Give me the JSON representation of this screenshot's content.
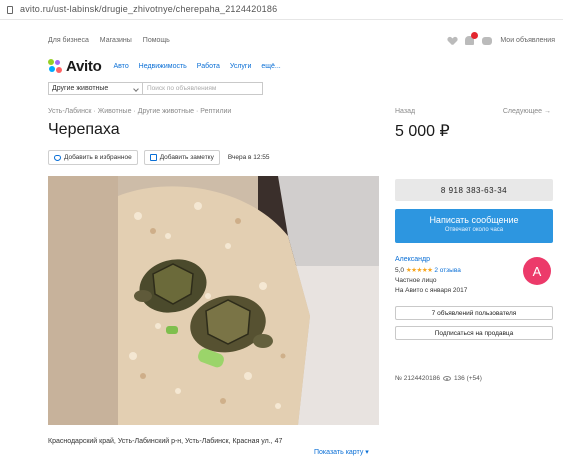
{
  "browser": {
    "url": "avito.ru/ust-labinsk/drugie_zhivotnye/cherepaha_2124420186"
  },
  "topnav": {
    "links": [
      "Для бизнеса",
      "Магазины",
      "Помощь"
    ],
    "my_ads": "Мои объявления"
  },
  "header": {
    "logo_text": "Avito",
    "category_links": [
      "Авто",
      "Недвижимость",
      "Работа",
      "Услуги",
      "ещё..."
    ]
  },
  "search": {
    "category_value": "Другие животные",
    "placeholder": "Поиск по объявлениям"
  },
  "breadcrumb": {
    "items": [
      "Усть-Лабинск",
      "Животные",
      "Другие животные",
      "Рептилии"
    ],
    "separator": " · "
  },
  "nav": {
    "prev": "Назад",
    "next": "Следующее →"
  },
  "listing": {
    "title": "Черепаха",
    "price": "5 000 ₽",
    "add_favorite": "Добавить в избранное",
    "add_note": "Добавить заметку",
    "views_today": "Вчера в 12:55",
    "address": "Краснодарский край, Усть-Лабинский р-н, Усть-Лабинск, Красная ул., 47",
    "show_map": "Показать карту ▾"
  },
  "seller": {
    "phone": "8 918 383-63-34",
    "message_button": "Написать сообщение",
    "message_sub": "Отвечает около часа",
    "name": "Александр",
    "rating": "5,0",
    "stars": "★★★★★",
    "reviews": "2 отзыва",
    "type": "Частное лицо",
    "since": "На Авито с января 2017",
    "avatar_letter": "А",
    "ads_button": "7 объявлений пользователя",
    "subscribe_button": "Подписаться на продавца"
  },
  "meta": {
    "ad_number": "№ 2124420186",
    "views": "136 (+54)"
  },
  "colors": {
    "accent_blue": "#2d96e0",
    "link_blue": "#0a6fd6",
    "avatar_pink": "#ec3a6a",
    "star_orange": "#f8a51c"
  }
}
